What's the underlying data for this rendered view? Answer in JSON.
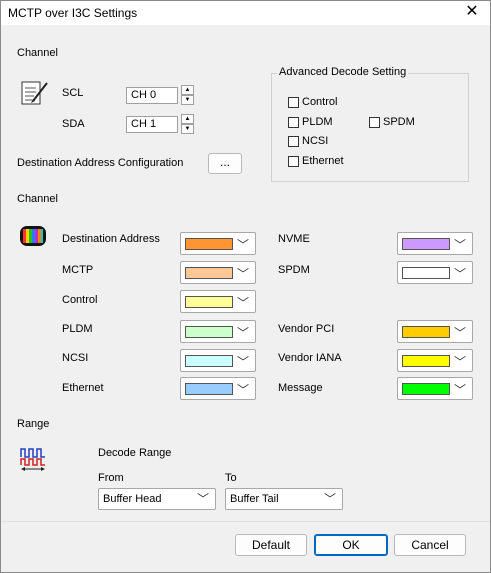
{
  "window": {
    "title": "MCTP over I3C Settings",
    "close_glyph": "✕"
  },
  "channel_section": {
    "heading": "Channel",
    "scl_label": "SCL",
    "scl_value": "CH 0",
    "sda_label": "SDA",
    "sda_value": "CH 1",
    "dest_addr_config_label": "Destination Address Configuration",
    "dest_addr_config_button": "...",
    "icon": "notepad-pen-icon"
  },
  "advanced": {
    "heading": "Advanced Decode Setting",
    "options": {
      "control": "Control",
      "pldm": "PLDM",
      "spdm": "SPDM",
      "ncsi": "NCSI",
      "ethernet": "Ethernet"
    }
  },
  "colors_section": {
    "heading": "Channel",
    "icon": "color-bars-icon",
    "items": {
      "destination_address": {
        "label": "Destination Address",
        "color": "#ff9433"
      },
      "mctp": {
        "label": "MCTP",
        "color": "#ffc896"
      },
      "control": {
        "label": "Control",
        "color": "#ffff99"
      },
      "pldm": {
        "label": "PLDM",
        "color": "#ccffcc"
      },
      "ncsi": {
        "label": "NCSI",
        "color": "#ccffff"
      },
      "ethernet": {
        "label": "Ethernet",
        "color": "#99ccff"
      },
      "nvme": {
        "label": "NVME",
        "color": "#cc99ff"
      },
      "spdm": {
        "label": "SPDM",
        "color": "#ffffff"
      },
      "vendor_pci": {
        "label": "Vendor PCI",
        "color": "#ffcc00"
      },
      "vendor_iana": {
        "label": "Vendor IANA",
        "color": "#ffff00"
      },
      "message": {
        "label": "Message",
        "color": "#00ff00"
      }
    }
  },
  "range": {
    "heading": "Range",
    "icon": "waveform-range-icon",
    "decode_range_label": "Decode Range",
    "from_label": "From",
    "from_value": "Buffer Head",
    "to_label": "To",
    "to_value": "Buffer Tail"
  },
  "buttons": {
    "default": "Default",
    "ok": "OK",
    "cancel": "Cancel"
  }
}
